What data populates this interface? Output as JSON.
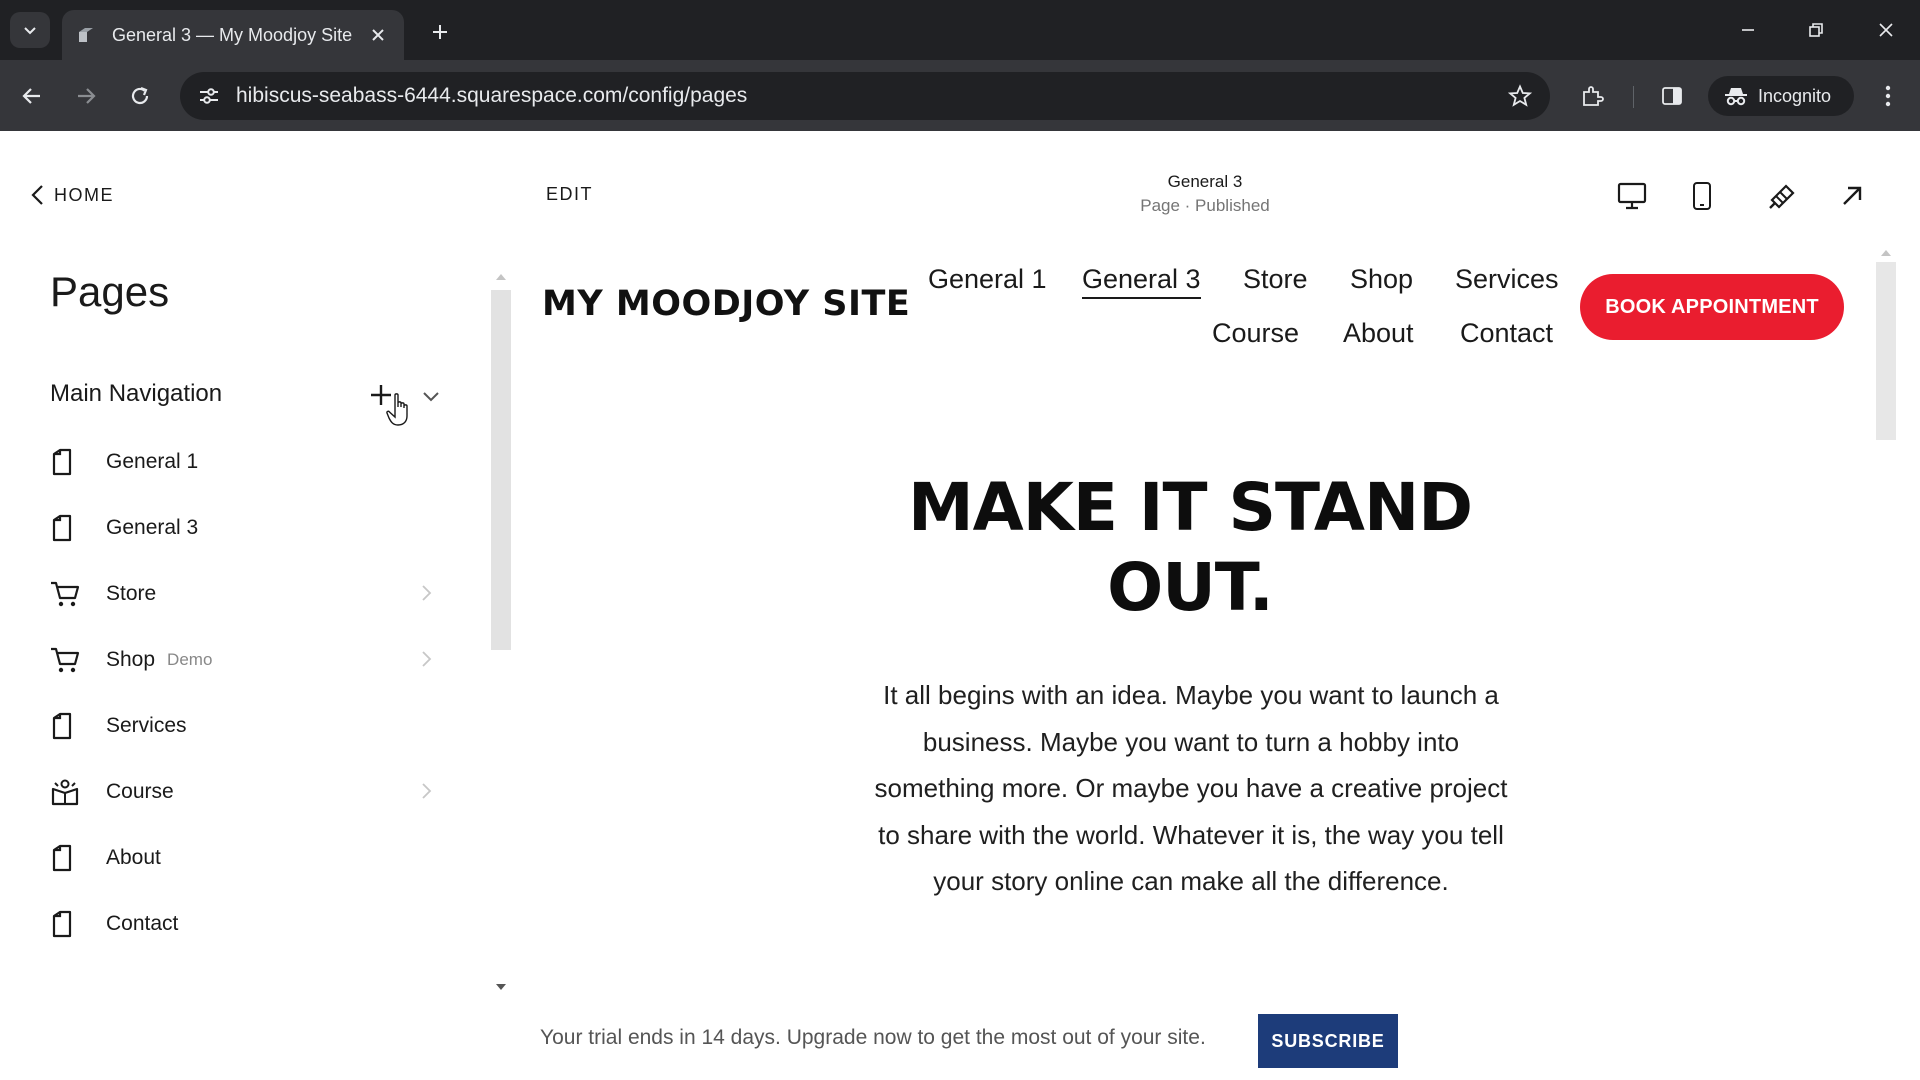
{
  "browser": {
    "tab_title": "General 3 — My Moodjoy Site",
    "url": "hibiscus-seabass-6444.squarespace.com/config/pages",
    "incognito_label": "Incognito"
  },
  "editor": {
    "home_label": "HOME",
    "edit_label": "EDIT",
    "page_name": "General 3",
    "page_status": "Page · Published"
  },
  "panel": {
    "title": "Pages",
    "section_label": "Main Navigation",
    "items": [
      {
        "label": "General 1",
        "icon": "page-icon"
      },
      {
        "label": "General 3",
        "icon": "page-icon"
      },
      {
        "label": "Store",
        "icon": "cart-icon",
        "has_chevron": true
      },
      {
        "label": "Shop",
        "tag": "Demo",
        "icon": "cart-icon",
        "has_chevron": true
      },
      {
        "label": "Services",
        "icon": "page-icon"
      },
      {
        "label": "Course",
        "icon": "course-icon",
        "has_chevron": true
      },
      {
        "label": "About",
        "icon": "page-icon"
      },
      {
        "label": "Contact",
        "icon": "page-icon"
      }
    ]
  },
  "site": {
    "logo": "MY MOODJOY SITE",
    "nav": [
      "General 1",
      "General 3",
      "Store",
      "Shop",
      "Services",
      "Course",
      "About",
      "Contact"
    ],
    "active_nav": "General 3",
    "cta": "BOOK APPOINTMENT",
    "hero_title": "MAKE IT STAND OUT.",
    "hero_body": "It all begins with an idea. Maybe you want to launch a business. Maybe you want to turn a hobby into something more. Or maybe you have a creative project to share with the world. Whatever it is, the way you tell your story online can make all the difference."
  },
  "banner": {
    "text": "Your trial ends in 14 days. Upgrade now to get the most out of your site.",
    "button": "SUBSCRIBE"
  },
  "colors": {
    "cta_red": "#ea1d2f",
    "subscribe_blue": "#1d3c7a",
    "chrome_dark": "#202124",
    "chrome_toolbar": "#35363a"
  }
}
